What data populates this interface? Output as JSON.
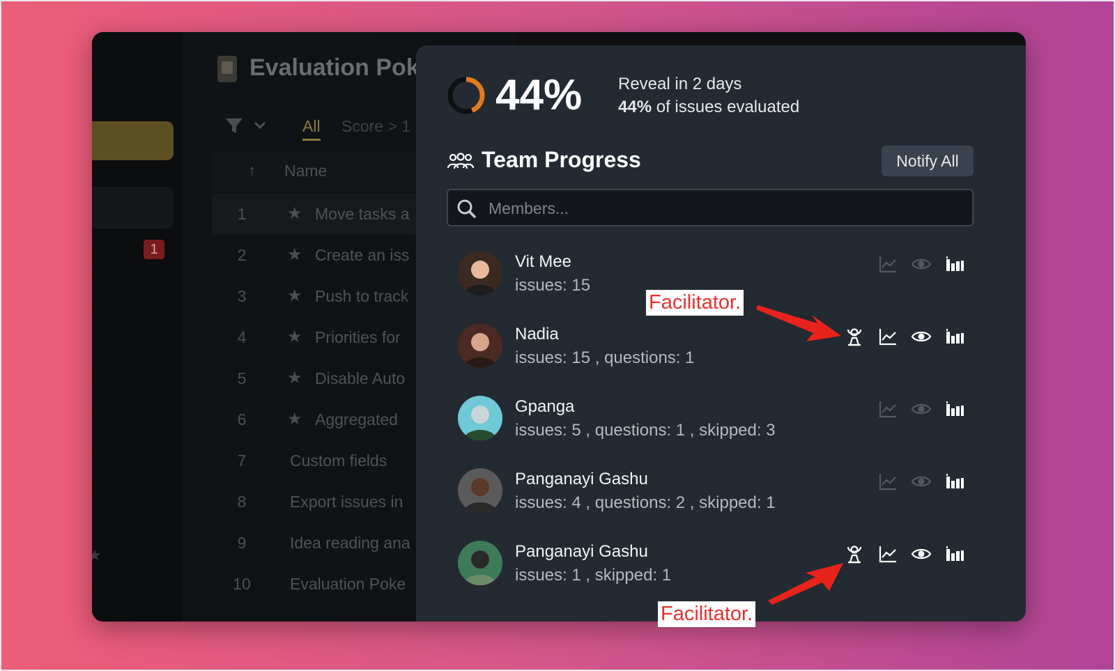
{
  "background_app": {
    "title": "Evaluation Poke",
    "filter_tabs": {
      "all": "All",
      "score": "Score > 1"
    },
    "badge_count": "1",
    "table": {
      "sort_arrow": "↑",
      "name_header": "Name",
      "rows": [
        {
          "num": "1",
          "starred": true,
          "name": "Move tasks a"
        },
        {
          "num": "2",
          "starred": true,
          "name": "Create an iss"
        },
        {
          "num": "3",
          "starred": true,
          "name": "Push to track"
        },
        {
          "num": "4",
          "starred": true,
          "name": "Priorities for"
        },
        {
          "num": "5",
          "starred": true,
          "name": "Disable Auto"
        },
        {
          "num": "6",
          "starred": true,
          "name": "Aggregated"
        },
        {
          "num": "7",
          "starred": false,
          "name": "Custom fields"
        },
        {
          "num": "8",
          "starred": false,
          "name": "Export issues in"
        },
        {
          "num": "9",
          "starred": false,
          "name": "Idea reading ana"
        },
        {
          "num": "10",
          "starred": false,
          "name": "Evaluation Poke"
        }
      ]
    }
  },
  "progress": {
    "percent": 44,
    "percent_label": "44%",
    "reveal_text": "Reveal in 2 days",
    "evaluated_pct": "44%",
    "evaluated_text": "of issues evaluated",
    "accent_color": "#e07a1f"
  },
  "team": {
    "title": "Team Progress",
    "notify_label": "Notify All",
    "search_placeholder": "Members...",
    "members": [
      {
        "name": "Vit Mee",
        "stats": "issues: 15",
        "facilitator": false,
        "active": false
      },
      {
        "name": "Nadia",
        "stats": "issues: 15 , questions: 1",
        "facilitator": true,
        "active": true
      },
      {
        "name": "Gpanga",
        "stats": "issues: 5 , questions: 1 , skipped: 3",
        "facilitator": false,
        "active": false
      },
      {
        "name": "Panganayi Gashu",
        "stats": "issues: 4 , questions: 2 , skipped: 1",
        "facilitator": false,
        "active": false
      },
      {
        "name": "Panganayi Gashu",
        "stats": "issues: 1 , skipped: 1",
        "facilitator": true,
        "active": true
      }
    ]
  },
  "annotations": {
    "top": "Facilitator.",
    "bottom": "Facilitator."
  }
}
